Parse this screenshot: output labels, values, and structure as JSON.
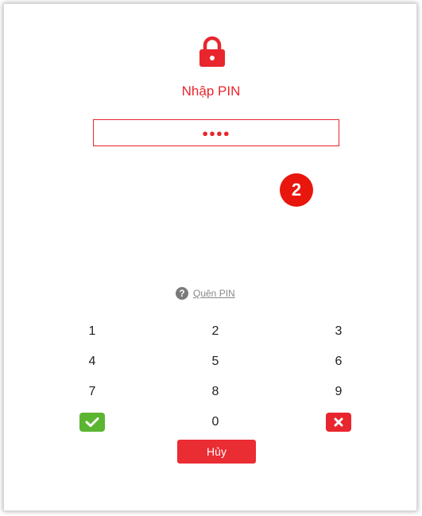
{
  "header": {
    "title": "Nhập PIN",
    "lock_icon": "lock-icon"
  },
  "pin_input": {
    "value": "●●●●"
  },
  "step_badge": {
    "label": "2"
  },
  "forgot_pin": {
    "icon": "question-icon",
    "label": "Quên PIN"
  },
  "keypad": {
    "keys": [
      "1",
      "2",
      "3",
      "4",
      "5",
      "6",
      "7",
      "8",
      "9",
      "0"
    ],
    "confirm_icon": "check-icon",
    "delete_icon": "close-icon"
  },
  "cancel_button": {
    "label": "Hủy"
  },
  "colors": {
    "accent": "#e8262d",
    "confirm": "#5cb531",
    "badge": "#e8160c"
  }
}
